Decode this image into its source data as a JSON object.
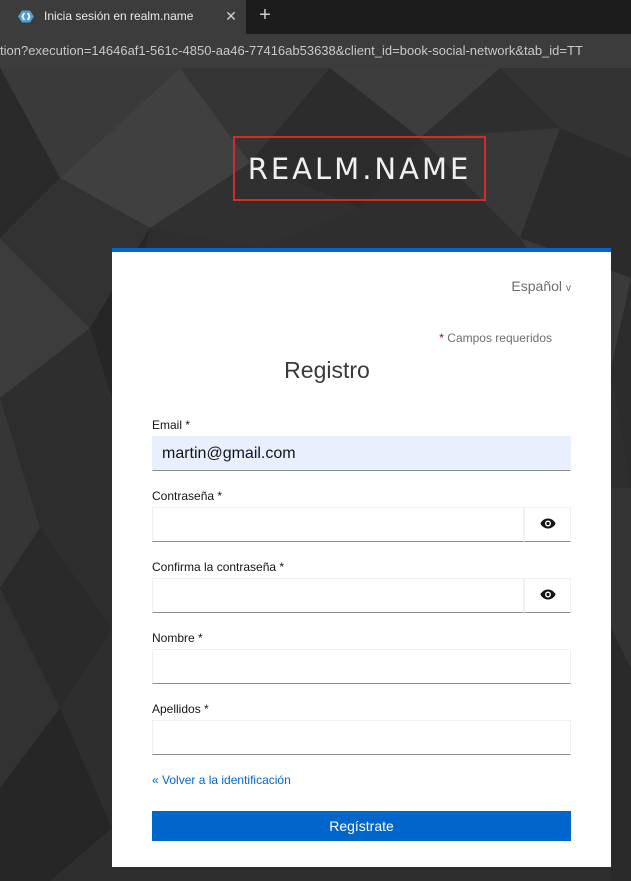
{
  "browser": {
    "tab_title": "Inicia sesión en realm.name",
    "tab_close": "✕",
    "new_tab": "+",
    "url": "tion?execution=14646af1-561c-4850-aa46-77416ab53638&client_id=book-social-network&tab_id=TT"
  },
  "brand": {
    "text": "REALM.NAME"
  },
  "card": {
    "language": "Español",
    "language_chevron": "v",
    "required_star": "*",
    "required_note": " Campos requeridos",
    "title": "Registro",
    "fields": {
      "email": {
        "label": "Email *",
        "value": "martin@gmail.com"
      },
      "password": {
        "label": "Contraseña *",
        "value": ""
      },
      "confirm": {
        "label": "Confirma la contraseña *",
        "value": ""
      },
      "first_name": {
        "label": "Nombre *",
        "value": ""
      },
      "last_name": {
        "label": "Apellidos *",
        "value": ""
      }
    },
    "back_link": "« Volver a la identificación",
    "submit": "Regístrate"
  },
  "colors": {
    "accent": "#0066cc",
    "brand_border": "#d12b2b",
    "required_star": "#a30000",
    "autofill": "#e8f0fe"
  },
  "icons": [
    "keycloak-favicon-icon",
    "close-icon",
    "plus-icon",
    "eye-icon",
    "chevron-down-icon"
  ]
}
